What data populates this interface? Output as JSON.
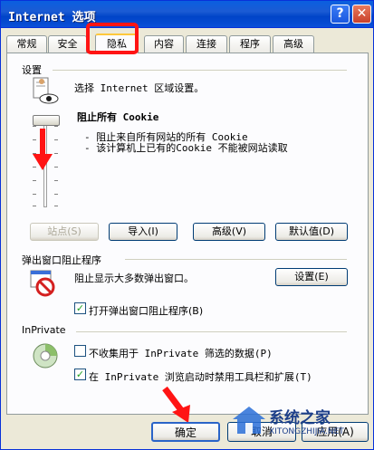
{
  "window": {
    "title": "Internet 选项"
  },
  "titlebar": {
    "help_glyph": "?",
    "close_glyph": "✕"
  },
  "tabs": [
    {
      "label": "常规"
    },
    {
      "label": "安全"
    },
    {
      "label": "隐私"
    },
    {
      "label": "内容"
    },
    {
      "label": "连接"
    },
    {
      "label": "程序"
    },
    {
      "label": "高级"
    }
  ],
  "active_tab": "隐私",
  "settings": {
    "group_label": "设置",
    "description": "选择 Internet 区域设置。",
    "level_title": "阻止所有 Cookie",
    "level_details": [
      "- 阻止来自所有网站的所有 Cookie",
      "- 该计算机上已有的Cookie 不能被网站读取"
    ],
    "slider_level": 1.0,
    "buttons": {
      "sites": "站点(S)",
      "import": "导入(I)",
      "advanced": "高级(V)",
      "default": "默认值(D)"
    }
  },
  "popup": {
    "group_label": "弹出窗口阻止程序",
    "description": "阻止显示大多数弹出窗口。",
    "settings_button": "设置(E)",
    "enable_checkbox": {
      "label": "打开弹出窗口阻止程序(B)",
      "checked": true
    }
  },
  "inprivate": {
    "group_label": "InPrivate",
    "filter_checkbox": {
      "label": "不收集用于 InPrivate 筛选的数据(P)",
      "checked": false
    },
    "toolbar_checkbox": {
      "label": "在 InPrivate 浏览启动时禁用工具栏和扩展(T)",
      "checked": true
    }
  },
  "footer": {
    "ok": "确定",
    "cancel": "取消",
    "apply": "应用(A)"
  },
  "watermark": {
    "brand": "系统之家",
    "site": "XITONGZHIJIA.NET"
  },
  "colors": {
    "accent_red": "#ff1414",
    "check_green": "#21a121",
    "title_blue": "#0a5fe0"
  }
}
